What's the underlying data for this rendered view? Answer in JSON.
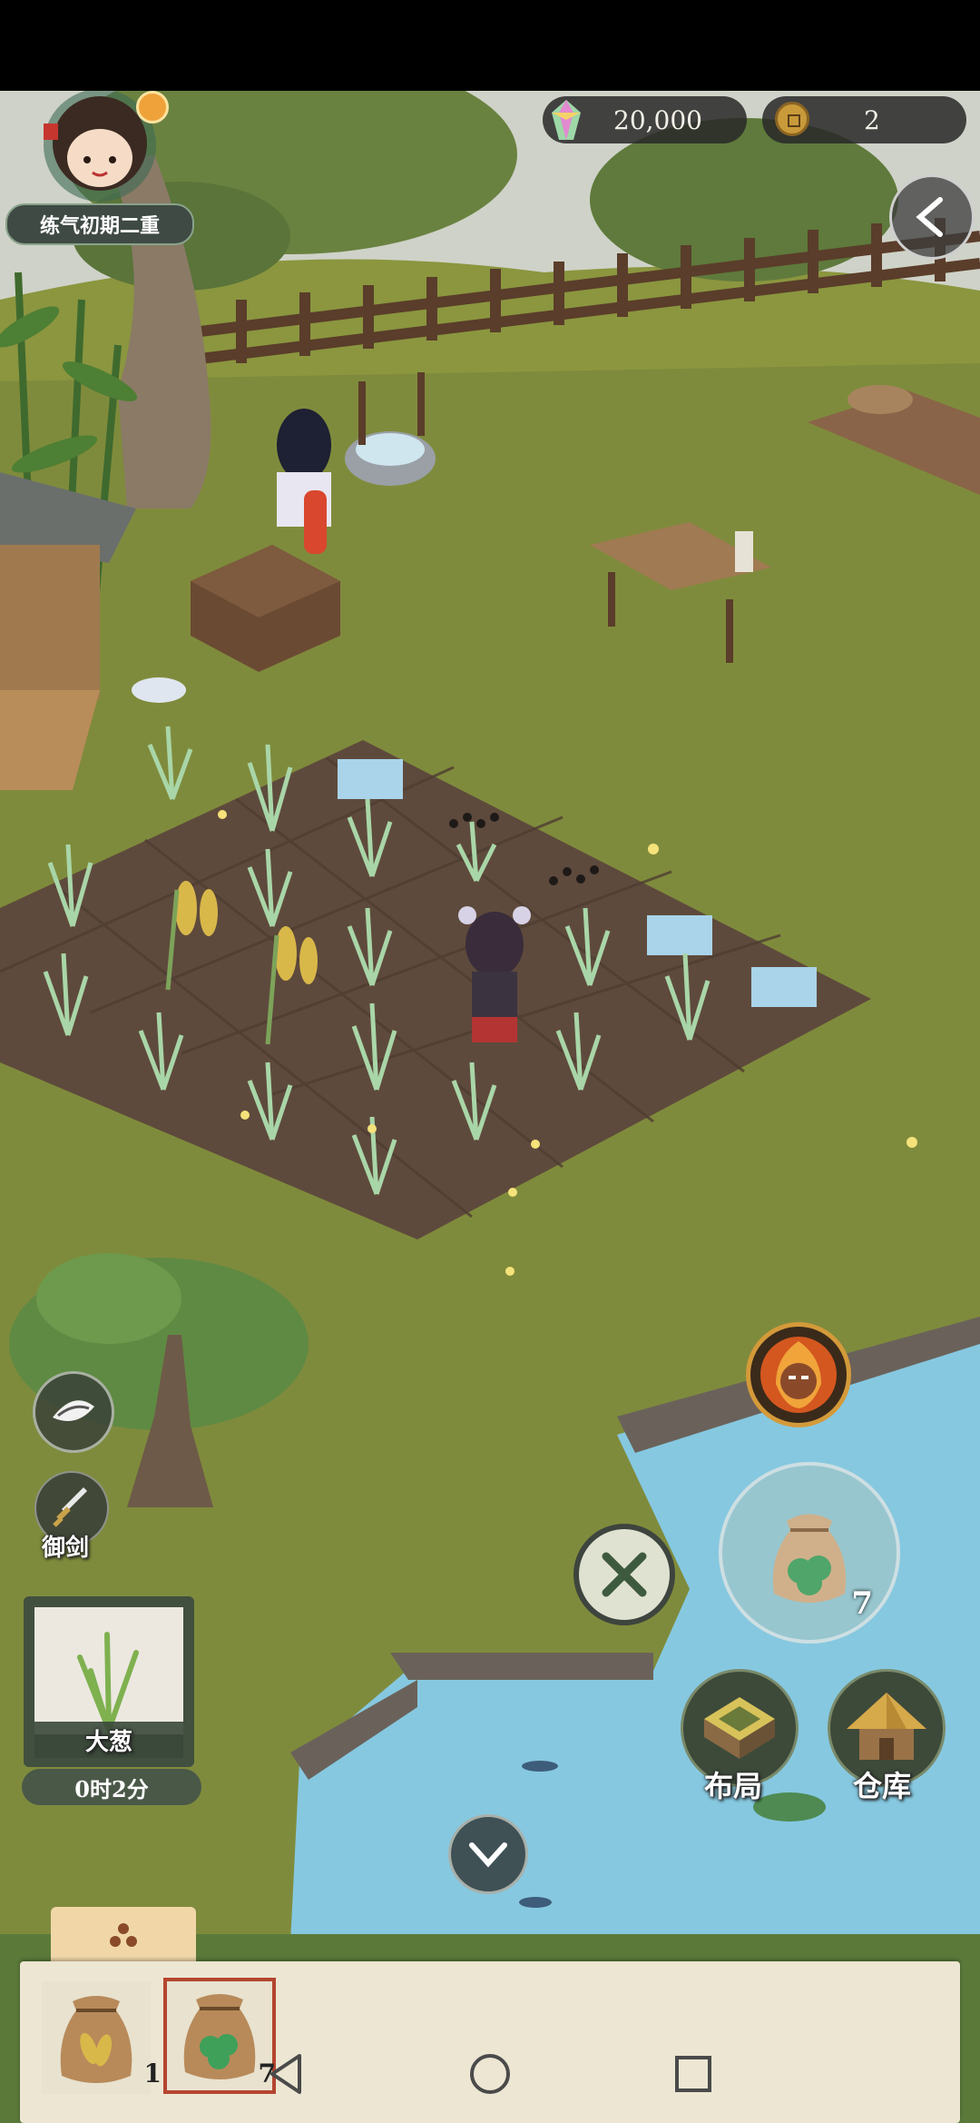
{
  "player": {
    "cultivation_stage": "练气初期二重",
    "avatar_icon": "girl-avatar-icon",
    "status_icon": "sun-icon"
  },
  "currency": {
    "spirit_stones": "20,000",
    "coins": "2"
  },
  "left_controls": {
    "sword_label": "御剑"
  },
  "crop_info": {
    "name": "大葱",
    "timer": "0时2分"
  },
  "action_buttons": {
    "seed_bag_count": "7",
    "layout_label": "布局",
    "warehouse_label": "仓库"
  },
  "inventory": {
    "items": [
      {
        "icon": "grain-seed-bag-icon",
        "count": "1"
      },
      {
        "icon": "leaf-seed-bag-icon",
        "count": "7"
      }
    ]
  },
  "colors": {
    "grass": "#7e8a3a",
    "soil": "#5e4a3c",
    "water": "#86c8e0",
    "panel": "#ece6d3",
    "accent_red": "#b4452f"
  }
}
